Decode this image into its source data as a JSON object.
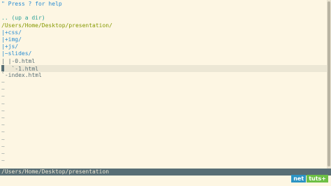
{
  "editor": {
    "lines": [
      {
        "text": "\" Press ? for help",
        "kind": "help"
      },
      {
        "text": "",
        "kind": "blank"
      },
      {
        "text": ".. (up a dir)",
        "kind": "updir"
      },
      {
        "text": "/Users/Home/Desktop/presentation/",
        "kind": "path"
      },
      {
        "text": "|+css/",
        "kind": "dir"
      },
      {
        "text": "|+img/",
        "kind": "dir"
      },
      {
        "text": "|+js/",
        "kind": "dir"
      },
      {
        "text": "|~slides/",
        "kind": "dir"
      },
      {
        "text": "| |-0.html",
        "kind": "file"
      },
      {
        "text": "|  `-1.html",
        "kind": "file"
      },
      {
        "text": "`-index.html",
        "kind": "file"
      }
    ],
    "tilde_char": "~"
  },
  "statusbar": {
    "path": "/Users/Home/Desktop/presentation"
  },
  "logo": {
    "net": "net",
    "tuts": "tuts+"
  }
}
